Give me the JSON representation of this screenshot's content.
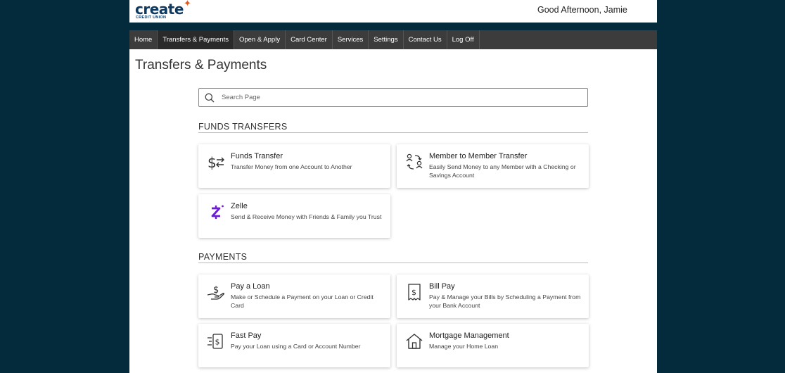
{
  "header": {
    "logo_word": "create",
    "logo_sub": "CREDIT UNION",
    "greeting": "Good Afternoon, Jamie"
  },
  "nav": {
    "items": [
      {
        "label": "Home"
      },
      {
        "label": "Transfers & Payments",
        "active": true
      },
      {
        "label": "Open & Apply"
      },
      {
        "label": "Card Center"
      },
      {
        "label": "Services"
      },
      {
        "label": "Settings"
      },
      {
        "label": "Contact Us"
      },
      {
        "label": "Log Off"
      }
    ]
  },
  "page": {
    "title": "Transfers & Payments"
  },
  "search": {
    "placeholder": "Search Page",
    "value": ""
  },
  "sections": {
    "funds": {
      "heading": "FUNDS TRANSFERS",
      "cards": [
        {
          "title": "Funds Transfer",
          "description": "Transfer Money from one Account to Another",
          "icon": "dollar-transfer-icon"
        },
        {
          "title": "Member to Member Transfer",
          "description": "Easily Send Money to any Member with a Checking or Savings Account",
          "icon": "member-transfer-icon"
        },
        {
          "title": "Zelle",
          "description": "Send & Receive Money with Friends & Family you Trust",
          "icon": "zelle-icon"
        }
      ]
    },
    "payments": {
      "heading": "PAYMENTS",
      "cards": [
        {
          "title": "Pay a Loan",
          "description": "Make or Schedule a Payment on your Loan or Credit Card",
          "icon": "hand-dollar-icon"
        },
        {
          "title": "Bill Pay",
          "description": "Pay & Manage your Bills by Scheduling a Payment from your Bank Account",
          "icon": "bill-icon"
        },
        {
          "title": "Fast Pay",
          "description": "Pay your Loan using a Card or Account Number",
          "icon": "fast-pay-icon"
        },
        {
          "title": "Mortgage Management",
          "description": "Manage your Home Loan",
          "icon": "house-icon"
        }
      ]
    }
  },
  "colors": {
    "background": "#032b3c",
    "nav": "#3c3c3c",
    "brand": "#0d3a63",
    "accent": "#e05a1f",
    "zelle": "#6d1ed4"
  }
}
